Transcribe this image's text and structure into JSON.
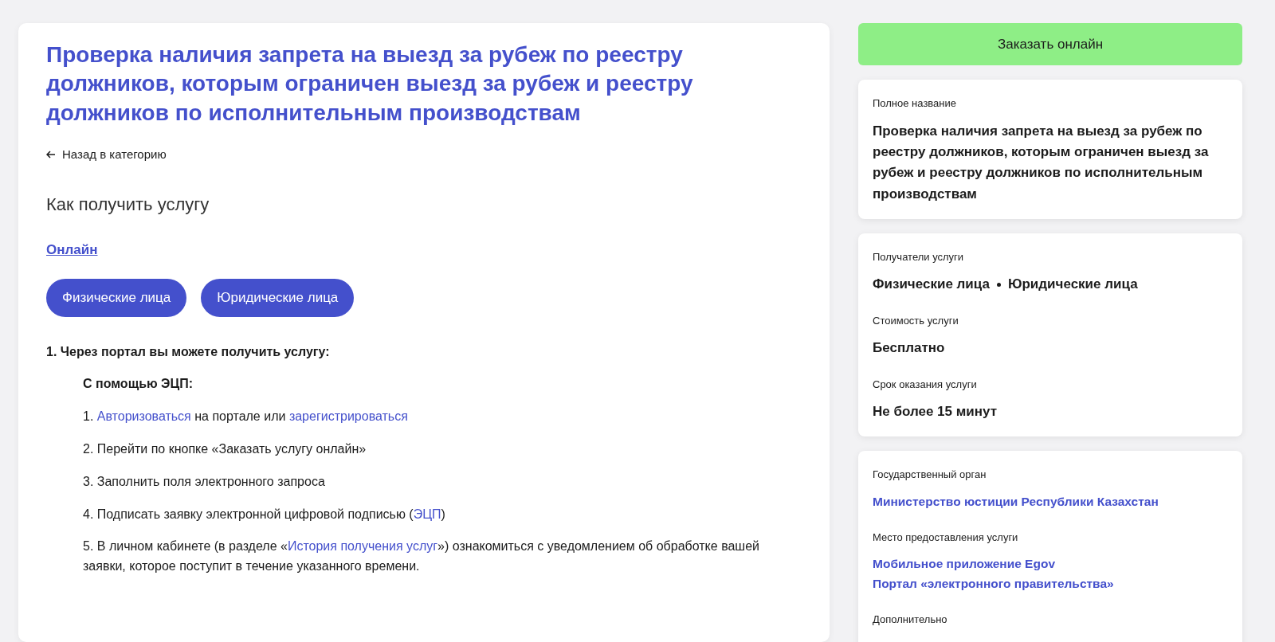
{
  "main": {
    "title": "Проверка наличия запрета на выезд за рубеж по реестру должников, которым ограничен выезд за рубеж и реестру должников по исполнительным производствам",
    "back_link": "Назад в категорию",
    "section_title": "Как получить услугу",
    "channel_link": "Онлайн",
    "recipient_buttons": [
      {
        "label": "Физические лица"
      },
      {
        "label": "Юридические лица"
      }
    ],
    "step_heading": "1. Через портал вы можете получить услугу:",
    "sub_heading": "С помощью ЭЦП:",
    "steps": [
      {
        "parts": [
          {
            "text": "1. ",
            "link": false
          },
          {
            "text": "Авторизоваться",
            "link": true
          },
          {
            "text": " на портале или ",
            "link": false
          },
          {
            "text": "зарегистрироваться",
            "link": true
          }
        ]
      },
      {
        "parts": [
          {
            "text": "2. Перейти по кнопке «Заказать услугу онлайн»",
            "link": false
          }
        ]
      },
      {
        "parts": [
          {
            "text": "3. Заполнить поля электронного запроса",
            "link": false
          }
        ]
      },
      {
        "parts": [
          {
            "text": "4. Подписать заявку электронной цифровой подписью (",
            "link": false
          },
          {
            "text": "ЭЦП",
            "link": true
          },
          {
            "text": ")",
            "link": false
          }
        ]
      },
      {
        "parts": [
          {
            "text": "5. В личном кабинете (в разделе «",
            "link": false
          },
          {
            "text": "История получения услуг",
            "link": true
          },
          {
            "text": "») ознакомиться с уведомлением об обработке вашей заявки, которое поступит в течение указанного времени.",
            "link": false
          }
        ]
      }
    ]
  },
  "sidebar": {
    "order_button": "Заказать онлайн",
    "cards": [
      {
        "fields": [
          {
            "label": "Полное название",
            "kind": "text",
            "values": [
              "Проверка наличия запрета на выезд за рубеж по реестру должников, которым ограничен выезд за рубеж и реестру должников по исполнительным производствам"
            ]
          }
        ]
      },
      {
        "fields": [
          {
            "label": "Получатели услуги",
            "kind": "dotted",
            "values": [
              "Физические лица",
              "Юридические лица"
            ]
          },
          {
            "label": "Стоимость услуги",
            "kind": "text",
            "values": [
              "Бесплатно"
            ]
          },
          {
            "label": "Срок оказания услуги",
            "kind": "text",
            "values": [
              "Не более 15 минут"
            ]
          }
        ]
      },
      {
        "fields": [
          {
            "label": "Государственный орган",
            "kind": "links",
            "values": [
              "Министерство юстиции Республики Казахстан"
            ]
          },
          {
            "label": "Место предоставления услуги",
            "kind": "links",
            "values": [
              "Мобильное приложение Egov",
              "Портал «электронного правительства»"
            ]
          },
          {
            "label": "Дополнительно",
            "kind": "text"
          }
        ]
      }
    ]
  }
}
